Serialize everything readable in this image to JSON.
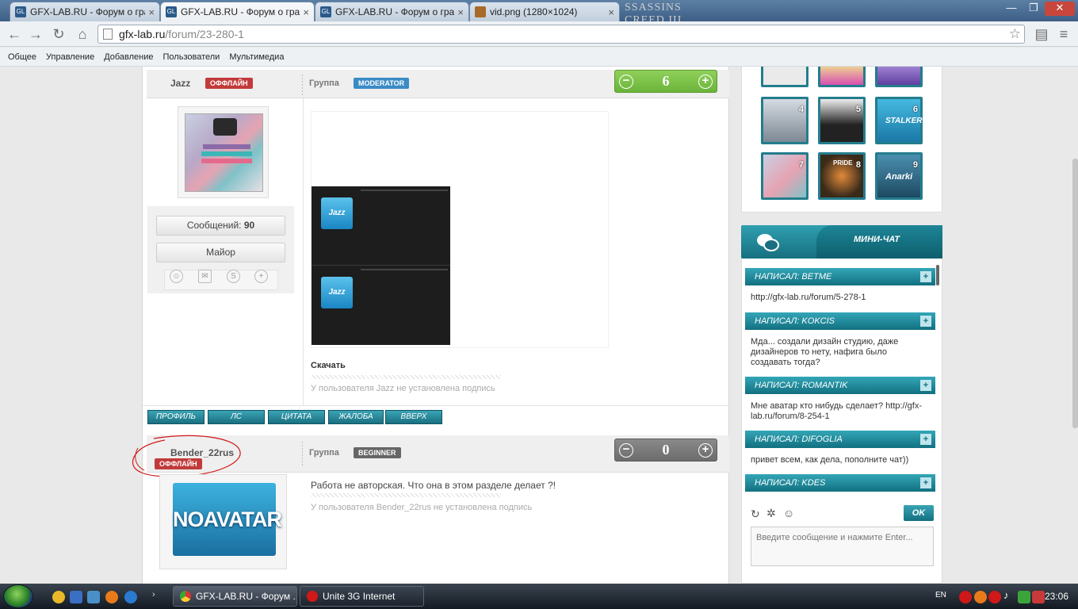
{
  "browser": {
    "tabs": [
      {
        "label": "GFX-LAB.RU - Форум о граф",
        "active": false
      },
      {
        "label": "GFX-LAB.RU - Форум о граф",
        "active": true
      },
      {
        "label": "GFX-LAB.RU - Форум о граф",
        "active": false
      },
      {
        "label": "vid.png (1280×1024)",
        "active": false
      }
    ],
    "favicon_text": "GL",
    "url_host": "gfx-lab.ru",
    "url_path": "/forum/23-280-1",
    "bookmarks": [
      "Общее",
      "Управление",
      "Добавление",
      "Пользователи",
      "Мультимедиа"
    ],
    "ac_logo_text": "SSASSINS CREED III"
  },
  "post1": {
    "username": "Jazz",
    "status": "ОФФЛАЙН",
    "group_label": "Группа",
    "group": "MODERATOR",
    "rating": "6",
    "messages_label": "Сообщений:",
    "messages_count": "90",
    "rank": "Майор",
    "download_label": "Скачать",
    "signature": "У пользователя Jazz не установлена подпись",
    "embedded_avatar_text": "Jazz"
  },
  "actions": [
    "ПРОФИЛЬ",
    "ЛС",
    "ЦИТАТА",
    "ЖАЛОБА",
    "ВВЕРХ"
  ],
  "post2": {
    "username": "Bender_22rus",
    "status": "ОФФЛАЙН",
    "group_label": "Группа",
    "group": "BEGINNER",
    "rating": "0",
    "avatar_text": "NOAVATAR",
    "message": "Работа не авторская. Что она в этом разделе делает ?!",
    "signature": "У пользователя Bender_22rus не установлена подпись"
  },
  "sidebar": {
    "thumb_numbers": [
      "4",
      "5",
      "6",
      "7",
      "8",
      "9"
    ],
    "thumb_labels": {
      "stalker": "STALKER",
      "anarki": "Anarki",
      "pride": "PRIDE"
    },
    "chat_title": "МИНИ-ЧАТ",
    "chat_messages": [
      {
        "author": "НАПИСАЛ: BETME",
        "text": "http://gfx-lab.ru/forum/5-278-1"
      },
      {
        "author": "НАПИСАЛ: KOKCIS",
        "text": "Мда... создали дизайн студию, даже дизайнеров то нету, нафига было создавать тогда?"
      },
      {
        "author": "НАПИСАЛ: ROMANTIK",
        "text": "Мне аватар кто нибудь сделает? http://gfx-lab.ru/forum/8-254-1"
      },
      {
        "author": "НАПИСАЛ: DIFOGLIA",
        "text": "привет всем, как дела, пополните чат))"
      },
      {
        "author": "НАПИСАЛ: KDES",
        "text": ""
      }
    ],
    "chat_ok": "OK",
    "chat_placeholder": "Введите сообщение и нажмите Enter..."
  },
  "taskbar": {
    "tasks": [
      "GFX-LAB.RU - Форум ...",
      "Unite 3G Internet"
    ],
    "lang": "EN",
    "clock": "23:06"
  },
  "colors": {
    "accent": "#1a7f90",
    "offline": "#c23b3b",
    "moderator": "#3a8bc6",
    "rating_green": "#6bb43a",
    "annotation": "#d01818"
  }
}
